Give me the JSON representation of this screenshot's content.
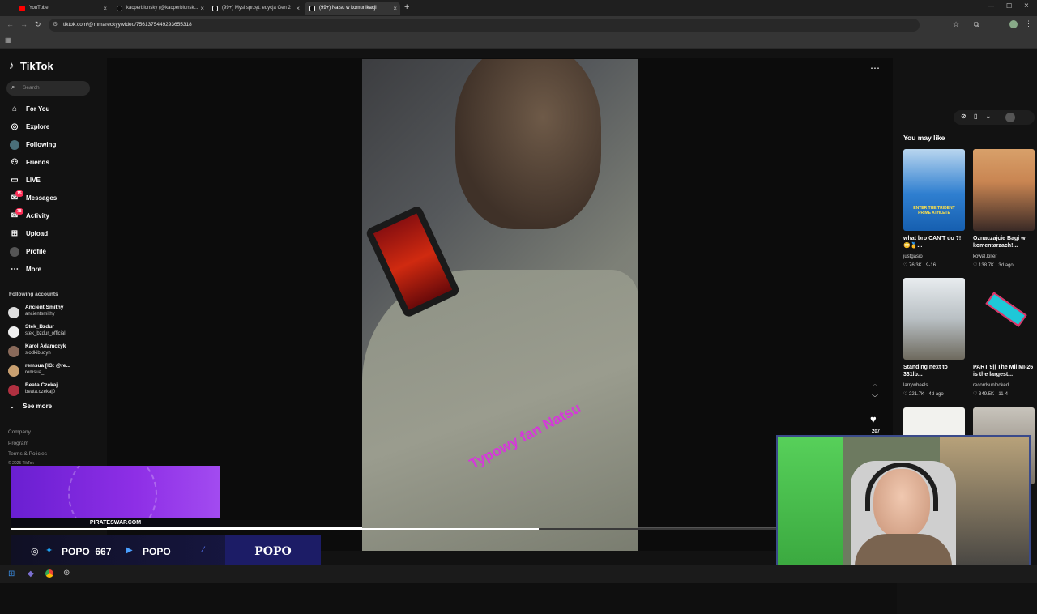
{
  "browser": {
    "tabs": [
      {
        "title": "YouTube",
        "color": "#ff0000"
      },
      {
        "title": "kacperblonsky (@kacperblonsk...",
        "color": "#ffffff"
      },
      {
        "title": "(99+) Mysl sprzęt: edycja Gen 2",
        "color": "#ffffff"
      },
      {
        "title": "(99+) Natsu w komunikacji",
        "color": "#ffffff"
      }
    ],
    "url": "tiktok.com/@mmareckyy/video/7561375449293655318",
    "new_tab": "+",
    "close": "×"
  },
  "tiktok": {
    "logo": "TikTok",
    "search_placeholder": "Search",
    "nav": [
      {
        "label": "For You",
        "icon": "home-icon"
      },
      {
        "label": "Explore",
        "icon": "compass-icon"
      },
      {
        "label": "Following",
        "icon": "following-icon"
      },
      {
        "label": "Friends",
        "icon": "friends-icon"
      },
      {
        "label": "LIVE",
        "icon": "live-icon"
      },
      {
        "label": "Messages",
        "icon": "messages-icon",
        "badge": "15"
      },
      {
        "label": "Activity",
        "icon": "activity-icon",
        "badge": "78"
      },
      {
        "label": "Upload",
        "icon": "upload-icon"
      },
      {
        "label": "Profile",
        "icon": "profile-icon"
      },
      {
        "label": "More",
        "icon": "more-icon"
      }
    ],
    "following_title": "Following accounts",
    "accounts": [
      {
        "name": "Ancient Smithy",
        "handle": "ancientsmithy"
      },
      {
        "name": "Stek_Bzdur",
        "handle": "stek_bzdur_official"
      },
      {
        "name": "Karol Adamczyk",
        "handle": "slodkibudyn"
      },
      {
        "name": "remsua [IG: @re...",
        "handle": "remsua_"
      },
      {
        "name": "Beata Czekaj",
        "handle": "beata.czekaj0"
      }
    ],
    "see_more": "See more",
    "footer_links": [
      "Company",
      "Program",
      "Terms & Policies"
    ],
    "copyright": "© 2025 TikTok",
    "video_caption": "Typowy fan Natsu",
    "like_count": "207",
    "you_may_like": "You may like",
    "suggestions": [
      {
        "title": "what bro CAN'T do ?! 😳🥇...",
        "user": "justgasio",
        "meta": "♡ 76.3K · 9-16"
      },
      {
        "title": "Oznaczajcie Bagi w komentarzach!...",
        "user": "kowal.killer",
        "meta": "♡ 138.7K · 3d ago"
      },
      {
        "title": "Standing next to 331lb...",
        "user": "larrywheels",
        "meta": "♡ 221.7K · 4d ago"
      },
      {
        "title": "PART 9|| The Mil MI-26 is the largest...",
        "user": "recordsunlocked",
        "meta": "♡ 349.5K · 11-4"
      },
      {
        "title": "",
        "user": "",
        "meta": ""
      },
      {
        "title": "",
        "user": "",
        "meta": ""
      }
    ],
    "thumb_text_1": "ENTER THE TRIDENT PRIME ATHLETE"
  },
  "stream": {
    "promo": "PIRATESWAP.COM",
    "twitter_handle": "POPO_667",
    "youtube_handle": "POPO",
    "brand": "POPO"
  }
}
